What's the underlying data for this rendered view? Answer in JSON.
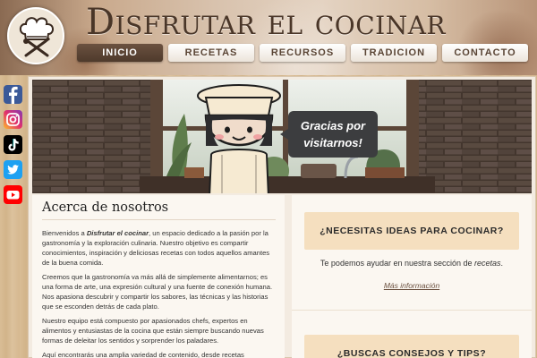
{
  "header": {
    "title": "Disfrutar el cocinar",
    "logo": "chef-hat-utensils-logo"
  },
  "nav": {
    "items": [
      {
        "label": "INICIO",
        "active": true
      },
      {
        "label": "RECETAS",
        "active": false
      },
      {
        "label": "RECURSOS",
        "active": false
      },
      {
        "label": "TRADICION",
        "active": false
      },
      {
        "label": "CONTACTO",
        "active": false
      }
    ]
  },
  "social": {
    "items": [
      {
        "name": "facebook-icon",
        "color": "#3b5998"
      },
      {
        "name": "instagram-icon",
        "color": "#d6249f"
      },
      {
        "name": "tiktok-icon",
        "color": "#000000"
      },
      {
        "name": "twitter-icon",
        "color": "#1da1f2"
      },
      {
        "name": "youtube-icon",
        "color": "#ff0000"
      }
    ]
  },
  "banner": {
    "speech": [
      "Gracias por",
      "visitarnos!"
    ]
  },
  "about": {
    "title": "Acerca de nosotros",
    "p1_before": "Bienvenidos a ",
    "p1_em": "Disfrutar el cocinar",
    "p1_after": ", un espacio dedicado a la pasión por la gastronomía y la exploración culinaria. Nuestro objetivo es compartir conocimientos, inspiración y deliciosas recetas con todos aquellos amantes de la buena comida.",
    "p2": "Creemos que la gastronomía va más allá de simplemente alimentarnos; es una forma de arte, una expresión cultural y una fuente de conexión humana. Nos apasiona descubrir y compartir los sabores, las técnicas y las historias que se esconden detrás de cada plato.",
    "p3": "Nuestro equipo está compuesto por apasionados chefs, expertos en alimentos y entusiastas de la cocina que están siempre buscando nuevas formas de deleitar los sentidos y sorprender los paladares.",
    "p4": "Aquí encontrarás una amplia variedad de contenido, desde recetas"
  },
  "cards": {
    "ideas": {
      "title": "¿NECESITAS IDEAS PARA COCINAR?",
      "text_before": "Te podemos ayudar en nuestra sección de ",
      "text_em": "recetas",
      "text_after": ".",
      "link": "Más información"
    },
    "tips": {
      "title": "¿BUSCAS CONSEJOS Y TIPS?"
    }
  },
  "colors": {
    "accent_dark": "#4e3a2c",
    "card_bg": "#f5dfbf",
    "speech_bg": "#3c3d3f"
  }
}
